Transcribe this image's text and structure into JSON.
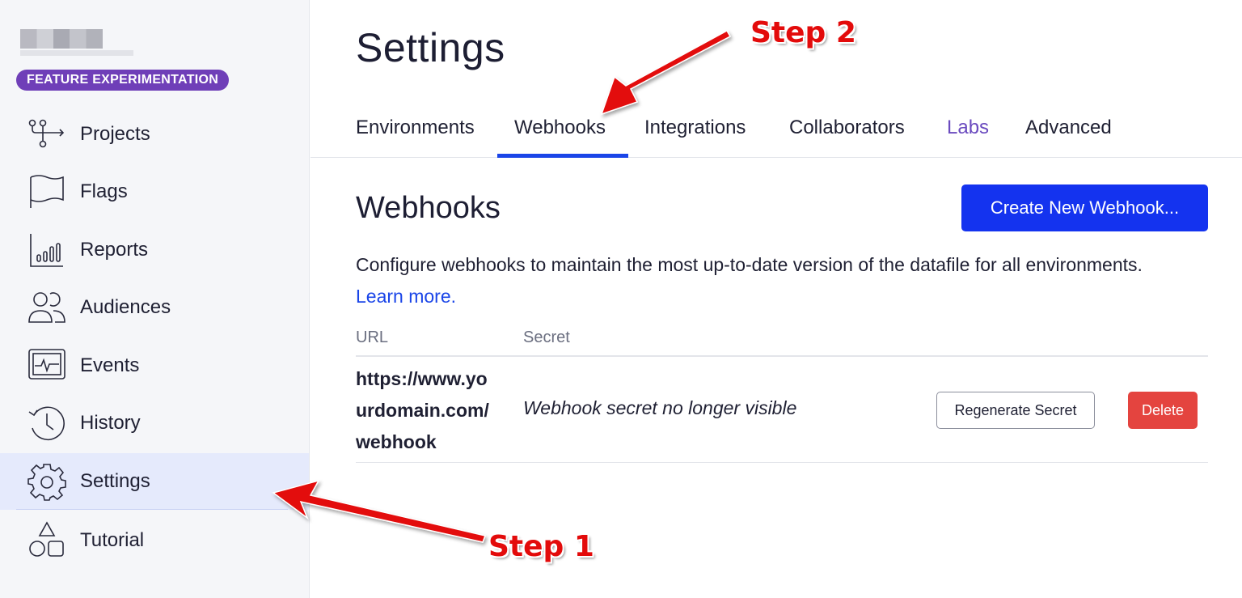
{
  "sidebar": {
    "badge": "FEATURE EXPERIMENTATION",
    "items": [
      {
        "label": "Projects",
        "icon": "projects-icon"
      },
      {
        "label": "Flags",
        "icon": "flag-icon"
      },
      {
        "label": "Reports",
        "icon": "reports-icon"
      },
      {
        "label": "Audiences",
        "icon": "audiences-icon"
      },
      {
        "label": "Events",
        "icon": "events-icon"
      },
      {
        "label": "History",
        "icon": "history-icon"
      },
      {
        "label": "Settings",
        "icon": "gear-icon",
        "active": true
      },
      {
        "label": "Tutorial",
        "icon": "tutorial-icon"
      }
    ]
  },
  "header": {
    "title": "Settings"
  },
  "tabs": [
    {
      "label": "Environments"
    },
    {
      "label": "Webhooks",
      "active": true
    },
    {
      "label": "Integrations"
    },
    {
      "label": "Collaborators"
    },
    {
      "label": "Labs"
    },
    {
      "label": "Advanced"
    }
  ],
  "webhooks": {
    "title": "Webhooks",
    "create_button": "Create New Webhook...",
    "description": "Configure webhooks to maintain the most up-to-date version of the datafile for all environments.",
    "learn_more": "Learn more.",
    "columns": [
      "URL",
      "Secret"
    ],
    "rows": [
      {
        "url": "https://www.yourdomain.com/webhook",
        "secret": "Webhook secret no longer visible",
        "regenerate_label": "Regenerate Secret",
        "delete_label": "Delete"
      }
    ]
  },
  "annotations": {
    "step1": "Step 1",
    "step2": "Step 2"
  },
  "colors": {
    "accent": "#1433ef",
    "badge": "#6f3fb8",
    "danger": "#e4443f",
    "active_nav": "#e5eafc",
    "annotation": "#e30b0b"
  }
}
